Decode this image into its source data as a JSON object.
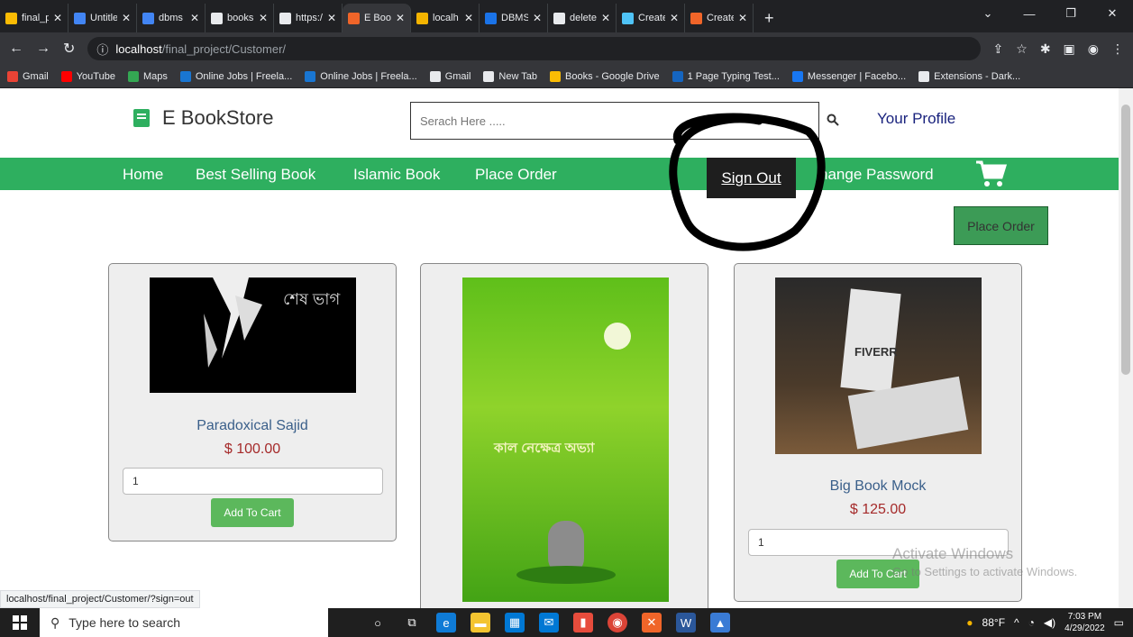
{
  "browser": {
    "tabs": [
      {
        "title": "final_p",
        "color": "#fbbc04"
      },
      {
        "title": "Untitle",
        "color": "#4285f4"
      },
      {
        "title": "dbms",
        "color": "#4285f4"
      },
      {
        "title": "books",
        "color": "#e8eaed"
      },
      {
        "title": "https:/",
        "color": "#e8eaed"
      },
      {
        "title": "E Book",
        "color": "#f06529",
        "active": true
      },
      {
        "title": "localh",
        "color": "#f4b400"
      },
      {
        "title": "DBMS",
        "color": "#1a73e8"
      },
      {
        "title": "delete",
        "color": "#e8eaed"
      },
      {
        "title": "Create",
        "color": "#4fc3f7"
      },
      {
        "title": "Create",
        "color": "#f06529"
      }
    ],
    "url_host": "localhost",
    "url_path": "/final_project/Customer/",
    "bookmarks": [
      {
        "label": "Gmail",
        "color": "#ea4335"
      },
      {
        "label": "YouTube",
        "color": "#ff0000"
      },
      {
        "label": "Maps",
        "color": "#34a853"
      },
      {
        "label": "Online Jobs | Freela...",
        "color": "#1976d2"
      },
      {
        "label": "Online Jobs | Freela...",
        "color": "#1976d2"
      },
      {
        "label": "Gmail",
        "color": "#e8eaed"
      },
      {
        "label": "New Tab",
        "color": "#e8eaed"
      },
      {
        "label": "Books - Google Drive",
        "color": "#fbbc04"
      },
      {
        "label": "1 Page Typing Test...",
        "color": "#1565c0"
      },
      {
        "label": "Messenger | Facebo...",
        "color": "#1877f2"
      },
      {
        "label": "Extensions - Dark...",
        "color": "#e8eaed"
      }
    ],
    "hover_url": "localhost/final_project/Customer/?sign=out"
  },
  "site": {
    "brand": "E BookStore",
    "search_placeholder": "Serach Here .....",
    "profile_link": "Your Profile",
    "nav": {
      "home": "Home",
      "best_selling": "Best Selling Book",
      "islamic": "Islamic Book",
      "place_order": "Place Order",
      "sign_out": "Sign Out",
      "change_password": "hange Password"
    },
    "place_order_button": "Place Order",
    "brand_color": "#2eaf5f",
    "products": [
      {
        "title": "Paradoxical Sajid",
        "price": "$ 100.00",
        "qty": "1",
        "add": "Add To Cart",
        "cover_text": "শেষ ভাগ"
      },
      {
        "title": "",
        "price": "",
        "qty": "",
        "add": "",
        "cover_text": "কাল নেক্ষেত্র অভ্যা"
      },
      {
        "title": "Big Book Mock",
        "price": "$ 125.00",
        "qty": "1",
        "add": "Add To Cart",
        "cover_text": "FIVERR"
      }
    ]
  },
  "watermark": {
    "line1": "Activate Windows",
    "line2": "Go to Settings to activate Windows."
  },
  "taskbar": {
    "search": "Type here to search",
    "temp": "88°F",
    "time": "7:03 PM",
    "date": "4/29/2022"
  }
}
